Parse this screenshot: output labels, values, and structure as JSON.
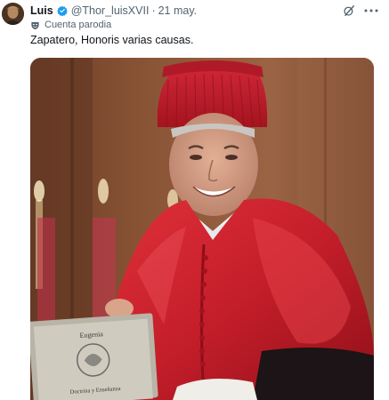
{
  "tweet": {
    "author_name": "Luis",
    "handle": "@Thor_luisXVII",
    "separator": "·",
    "date": "21 may.",
    "label": "Cuenta parodia",
    "text": "Zapatero, Honoris varias causas."
  },
  "photo": {
    "book_title": "Eugenia",
    "book_subtitle": "Doctrina y Enseñanza"
  },
  "icons": {
    "verified": "verified-badge-icon",
    "parody": "parody-mask-icon",
    "grok": "grok-icon",
    "more": "more-icon"
  },
  "colors": {
    "verified_blue": "#1d9bf0",
    "secondary_text": "#536471",
    "primary_text": "#0f1419"
  }
}
